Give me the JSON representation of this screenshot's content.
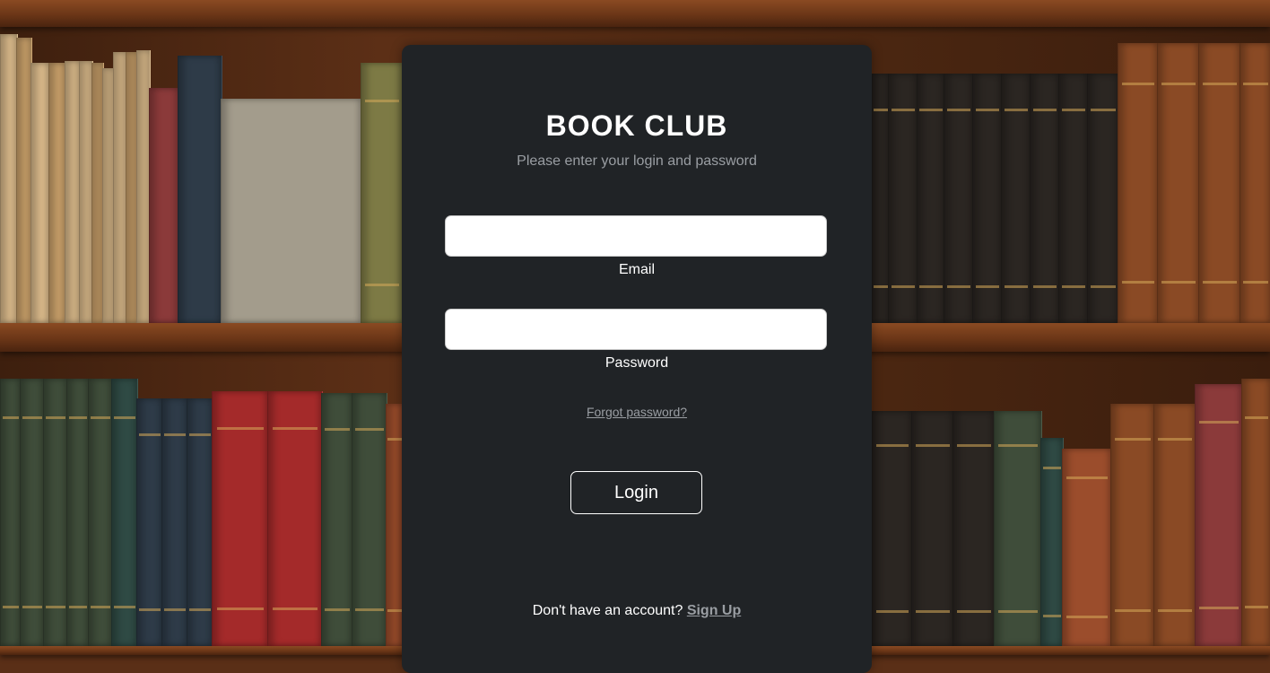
{
  "app": {
    "title": "BOOK CLUB",
    "subtitle": "Please enter your login and password"
  },
  "form": {
    "email": {
      "label": "Email",
      "value": "",
      "placeholder": ""
    },
    "password": {
      "label": "Password",
      "value": "",
      "placeholder": ""
    },
    "forgot_label": "Forgot password?",
    "login_label": "Login"
  },
  "footer": {
    "prompt": "Don't have an account?",
    "signup_label": "Sign Up"
  },
  "colors": {
    "panel_bg": "#202326",
    "muted_text": "#9a9ea3",
    "text": "#ffffff",
    "shelf_wood": "#6b3617"
  }
}
